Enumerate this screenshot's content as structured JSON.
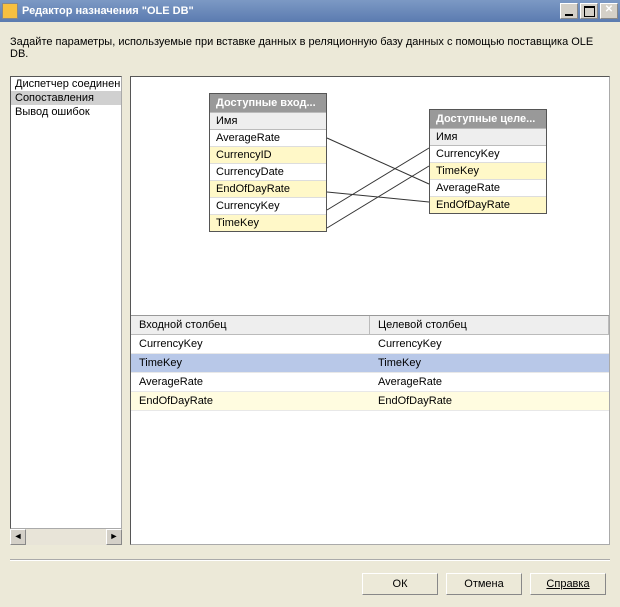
{
  "title": "Редактор назначения \"OLE DB\"",
  "description": "Задайте параметры, используемые при вставке данных в реляционную базу данных с помощью поставщика OLE DB.",
  "sidebar": {
    "items": [
      {
        "label": "Диспетчер соединений"
      },
      {
        "label": "Сопоставления"
      },
      {
        "label": "Вывод ошибок"
      }
    ]
  },
  "diagram": {
    "leftBox": {
      "title": "Доступные вход...",
      "subhead": "Имя",
      "rows": [
        {
          "label": "AverageRate",
          "hl": false
        },
        {
          "label": "CurrencyID",
          "hl": true
        },
        {
          "label": "CurrencyDate",
          "hl": false
        },
        {
          "label": "EndOfDayRate",
          "hl": true
        },
        {
          "label": "CurrencyKey",
          "hl": false
        },
        {
          "label": "TimeKey",
          "hl": true
        }
      ]
    },
    "rightBox": {
      "title": "Доступные целе...",
      "subhead": "Имя",
      "rows": [
        {
          "label": "CurrencyKey",
          "hl": false
        },
        {
          "label": "TimeKey",
          "hl": true
        },
        {
          "label": "AverageRate",
          "hl": false
        },
        {
          "label": "EndOfDayRate",
          "hl": true
        }
      ]
    }
  },
  "grid": {
    "headers": {
      "c1": "Входной столбец",
      "c2": "Целевой столбец"
    },
    "rows": [
      {
        "c1": "CurrencyKey",
        "c2": "CurrencyKey",
        "cls": ""
      },
      {
        "c1": "TimeKey",
        "c2": "TimeKey",
        "cls": "sel"
      },
      {
        "c1": "AverageRate",
        "c2": "AverageRate",
        "cls": ""
      },
      {
        "c1": "EndOfDayRate",
        "c2": "EndOfDayRate",
        "cls": "hl"
      }
    ]
  },
  "buttons": {
    "ok": "ОК",
    "cancel": "Отмена",
    "help": "Справка"
  }
}
